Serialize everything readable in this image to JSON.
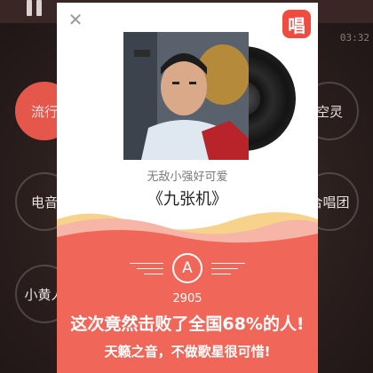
{
  "background": {
    "time": "03:32",
    "genres_left": [
      "流行",
      "电音",
      "小黄人"
    ],
    "genres_right": [
      "空灵",
      "合唱团"
    ]
  },
  "card": {
    "close_icon": "close-icon",
    "brand_logo": "唱",
    "singer": "无敌小强好可爱",
    "song": "《九张机》",
    "grade": "A",
    "score": "2905",
    "result": "这次竟然击败了全国68%的人!",
    "comment": "天籁之音，不做歌星很可惜!"
  },
  "colors": {
    "accent": "#ef4b3f",
    "panel_red": "#f0675a",
    "wave_yellow": "#f7d28a",
    "wave_pink": "#f6b5a6"
  }
}
